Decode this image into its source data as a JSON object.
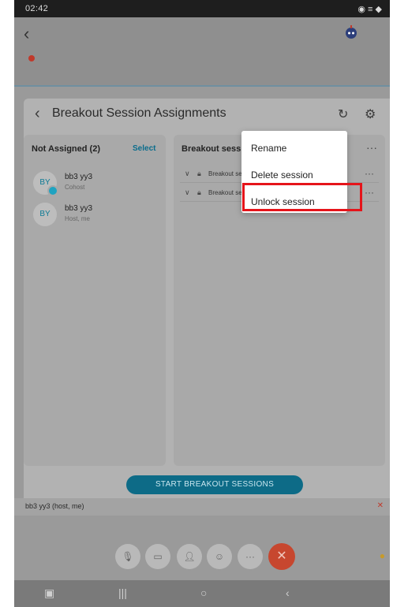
{
  "status_bar": {
    "time": "02:42",
    "signal_text": "◉ ≡ ◆"
  },
  "sheet": {
    "title": "Breakout Session Assignments"
  },
  "left_panel": {
    "title": "Not Assigned (2)",
    "select_label": "Select",
    "people": [
      {
        "initials": "BY",
        "name": "bb3 yy3",
        "role": "Cohost"
      },
      {
        "initials": "BY",
        "name": "bb3 yy3",
        "role": "Host, me"
      }
    ]
  },
  "right_panel": {
    "title": "Breakout sessions",
    "sessions": [
      {
        "name": "Breakout session 1"
      },
      {
        "name": "Breakout session 2"
      }
    ]
  },
  "context_menu": {
    "items": [
      "Rename",
      "Delete session",
      "Unlock session"
    ]
  },
  "start_button": {
    "label": "START BREAKOUT SESSIONS"
  },
  "user_strip": {
    "text": "bb3 yy3 (host, me)"
  },
  "colors": {
    "accent": "#0d6b87",
    "end_call": "#c7472f",
    "highlight": "#e5141a"
  },
  "icons": [
    "back-icon",
    "refresh-icon",
    "gear-icon",
    "chevron-down-icon",
    "lock-icon",
    "more-icon",
    "mic-off-icon",
    "video-off-icon",
    "participants-icon",
    "reactions-icon",
    "close-icon"
  ]
}
